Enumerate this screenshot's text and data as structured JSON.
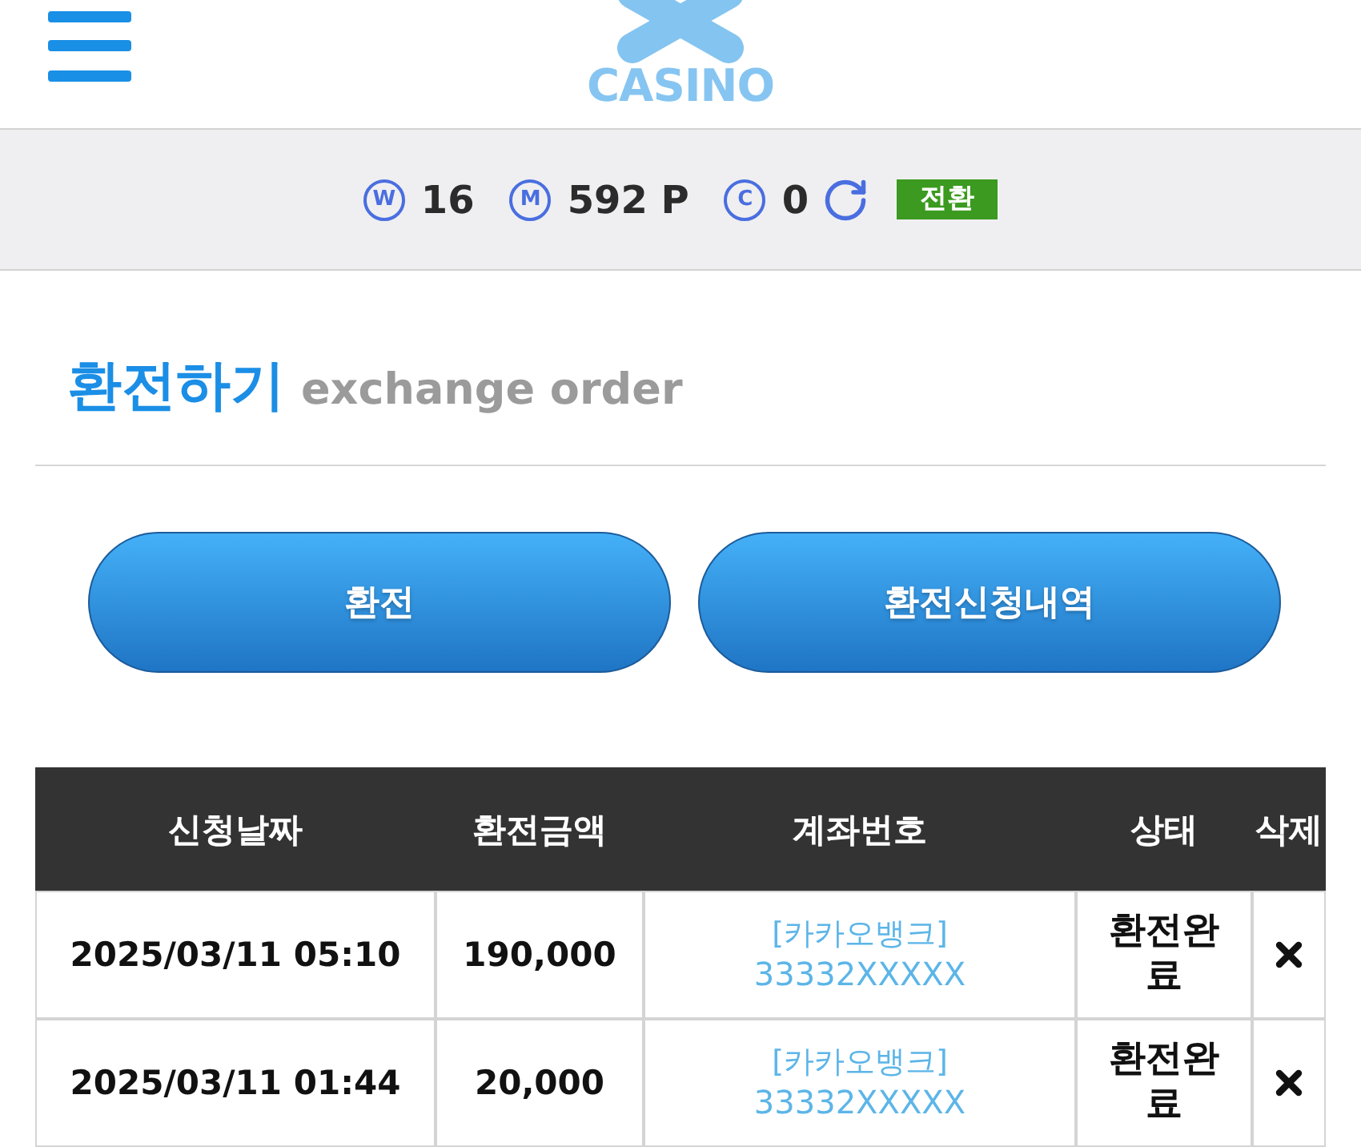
{
  "header": {
    "logo_text": "CASINO"
  },
  "balances": [
    {
      "mark": "W",
      "amount": "16"
    },
    {
      "mark": "M",
      "amount": "592 P"
    },
    {
      "mark": "C",
      "amount": "0"
    }
  ],
  "convert_button": "전환",
  "section": {
    "title": "환전하기",
    "subtitle": "exchange order"
  },
  "action_buttons": [
    "환전",
    "환전신청내역"
  ],
  "table": {
    "columns": [
      "신청날짜",
      "환전금액",
      "계좌번호",
      "상태",
      "삭제"
    ],
    "rows": [
      {
        "date": "2025/03/11 05:10",
        "amount": "190,000",
        "bank": "[카카오뱅크]",
        "account": "33332XXXXX",
        "status": "환전완료"
      },
      {
        "date": "2025/03/11 01:44",
        "amount": "20,000",
        "bank": "[카카오뱅크]",
        "account": "33332XXXXX",
        "status": "환전완료"
      }
    ]
  }
}
